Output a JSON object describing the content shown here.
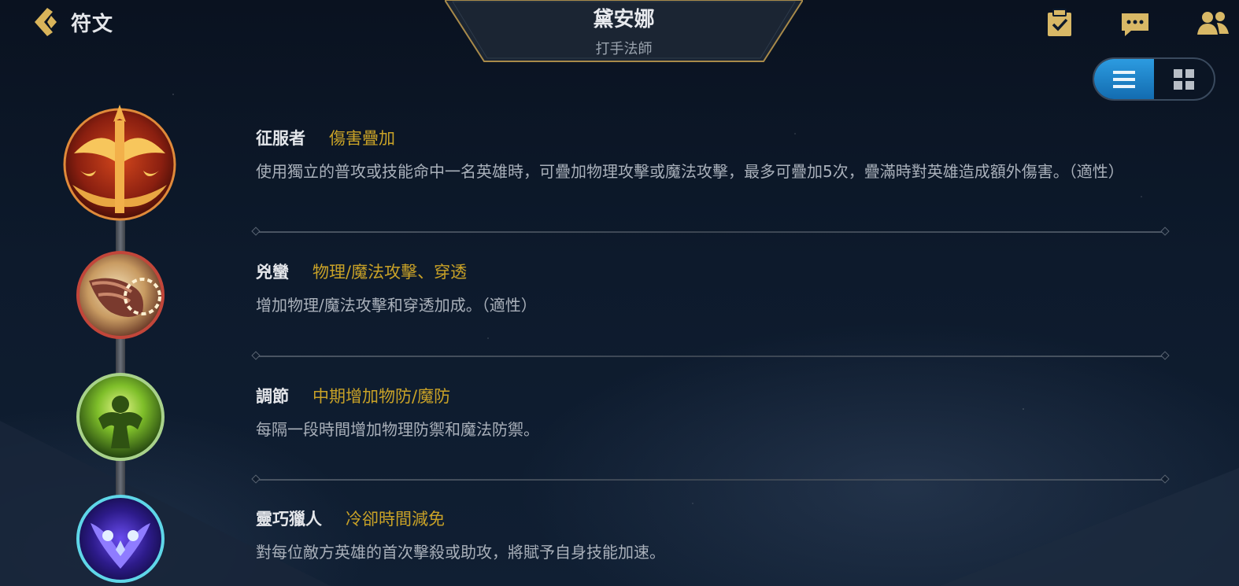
{
  "header": {
    "back_label": "符文",
    "hero_name": "黛安娜",
    "hero_class": "打手法師",
    "icons": [
      "tasks-icon",
      "chat-icon",
      "friends-icon"
    ]
  },
  "view_toggle": {
    "options": [
      "list-view-icon",
      "grid-view-icon"
    ],
    "active": "list-view-icon",
    "active_color": "#1f86cc"
  },
  "runes": [
    {
      "name": "征服者",
      "tag": "傷害疊加",
      "description": "使用獨立的普攻或技能命中一名英雄時，可疊加物理攻擊或魔法攻擊，最多可疊加5次，疊滿時對英雄造成額外傷害。（適性）",
      "icon": "conqueror-icon"
    },
    {
      "name": "兇蠻",
      "tag": "物理/魔法攻擊、穿透",
      "description": "增加物理/魔法攻擊和穿透加成。（適性）",
      "icon": "brutal-icon"
    },
    {
      "name": "調節",
      "tag": "中期增加物防/魔防",
      "description": "每隔一段時間增加物理防禦和魔法防禦。",
      "icon": "conditioning-icon"
    },
    {
      "name": "靈巧獵人",
      "tag": "冷卻時間減免",
      "description": "對每位敵方英雄的首次擊殺或助攻，將賦予自身技能加速。",
      "icon": "ingenious-hunter-icon"
    }
  ],
  "colors": {
    "tag": "#c9a227",
    "name": "#e4e6ea",
    "description": "#a9b0ba"
  }
}
